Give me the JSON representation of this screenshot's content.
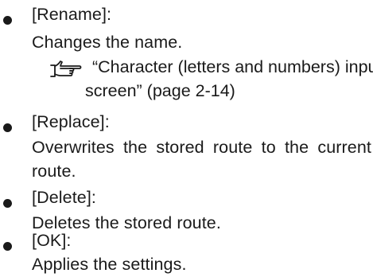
{
  "items": [
    {
      "label": "[Rename]:",
      "description": "Changes the name.",
      "reference": {
        "icon": "pointing-hand-reference-icon",
        "text_line1": "“Character (letters and numbers) input",
        "text_line2": "screen” (page 2-14)"
      }
    },
    {
      "label": "[Replace]:",
      "description_line1": "Overwrites the stored route to the current",
      "description_line2": "route."
    },
    {
      "label": "[Delete]:",
      "description": "Deletes the stored route."
    },
    {
      "label": "[OK]:",
      "description": "Applies the settings."
    }
  ]
}
